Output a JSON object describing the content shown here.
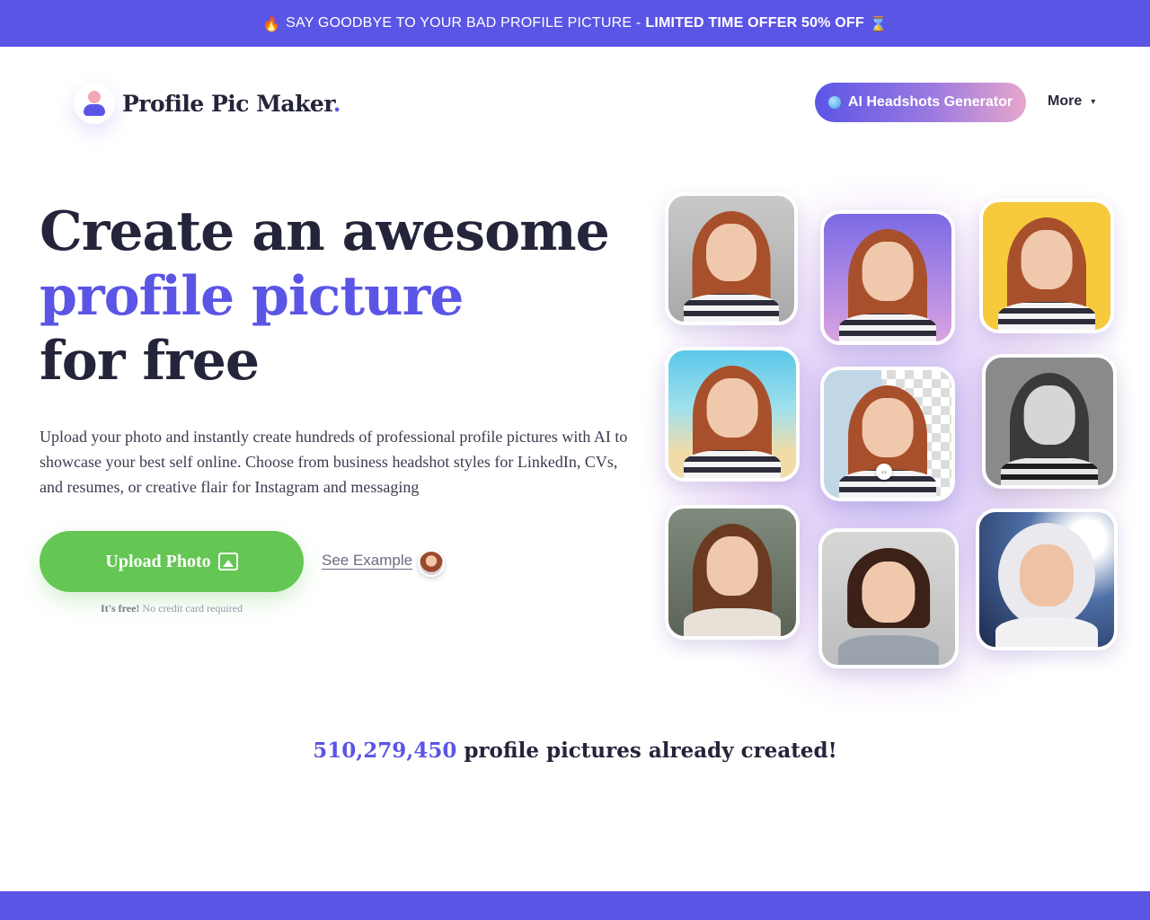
{
  "promo": {
    "fire_emoji": "🔥",
    "text": "SAY GOODBYE TO YOUR BAD PROFILE PICTURE -",
    "offer": "LIMITED TIME OFFER 50% OFF",
    "hourglass_emoji": "⌛"
  },
  "header": {
    "logo_text": "Profile Pic Maker",
    "logo_dot": ".",
    "ai_button": "AI Headshots Generator",
    "more_label": "More",
    "more_caret": "▾"
  },
  "hero": {
    "title_line1": "Create an awesome",
    "title_accent": "profile picture",
    "title_line3": "for free",
    "description": "Upload your photo and instantly create hundreds of professional profile pictures with AI to showcase your best self online. Choose from business headshot styles for LinkedIn, CVs, and resumes, or creative flair for Instagram and messaging",
    "upload_button": "Upload Photo",
    "free_bold": "It's free!",
    "free_rest": "No credit card required",
    "see_example": "See Example",
    "slider_handle": "‹›"
  },
  "stats": {
    "count": "510,279,450",
    "label": "profile pictures already created!"
  },
  "colors": {
    "brand": "#5b55e6",
    "upload_green": "#64c653",
    "title_dark": "#24243a"
  }
}
